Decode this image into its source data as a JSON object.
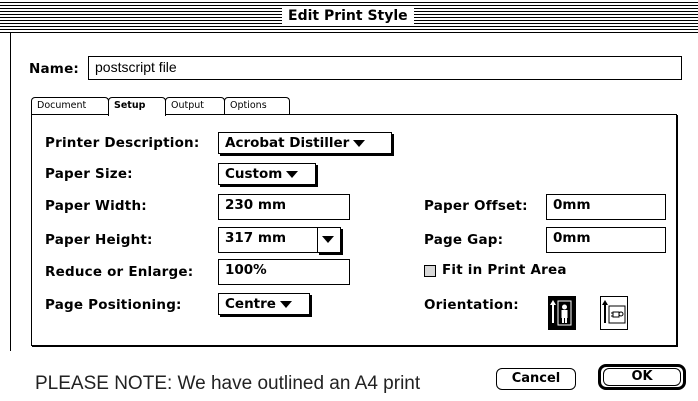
{
  "window": {
    "title": "Edit Print Style"
  },
  "name_field": {
    "label": "Name:",
    "value": "postscript file"
  },
  "tabs": [
    {
      "label": "Document",
      "active": false
    },
    {
      "label": "Setup",
      "active": true
    },
    {
      "label": "Output",
      "active": false
    },
    {
      "label": "Options",
      "active": false
    }
  ],
  "setup": {
    "printer_description": {
      "label": "Printer Description:",
      "value": "Acrobat Distiller"
    },
    "paper_size": {
      "label": "Paper Size:",
      "value": "Custom"
    },
    "paper_width": {
      "label": "Paper Width:",
      "value": "230 mm"
    },
    "paper_height": {
      "label": "Paper Height:",
      "value": "317 mm"
    },
    "reduce_enlarge": {
      "label": "Reduce or Enlarge:",
      "value": "100%"
    },
    "page_positioning": {
      "label": "Page Positioning:",
      "value": "Centre"
    },
    "paper_offset": {
      "label": "Paper Offset:",
      "value": "0mm"
    },
    "page_gap": {
      "label": "Page Gap:",
      "value": "0mm"
    },
    "fit_in_print_area": {
      "label": "Fit in Print Area",
      "checked": false
    },
    "orientation": {
      "label": "Orientation:",
      "selected": "portrait",
      "icons": [
        "portrait-icon",
        "landscape-icon"
      ]
    }
  },
  "buttons": {
    "cancel": "Cancel",
    "ok": "OK"
  },
  "note": {
    "text": "PLEASE NOTE: We have outlined an A4 print"
  }
}
